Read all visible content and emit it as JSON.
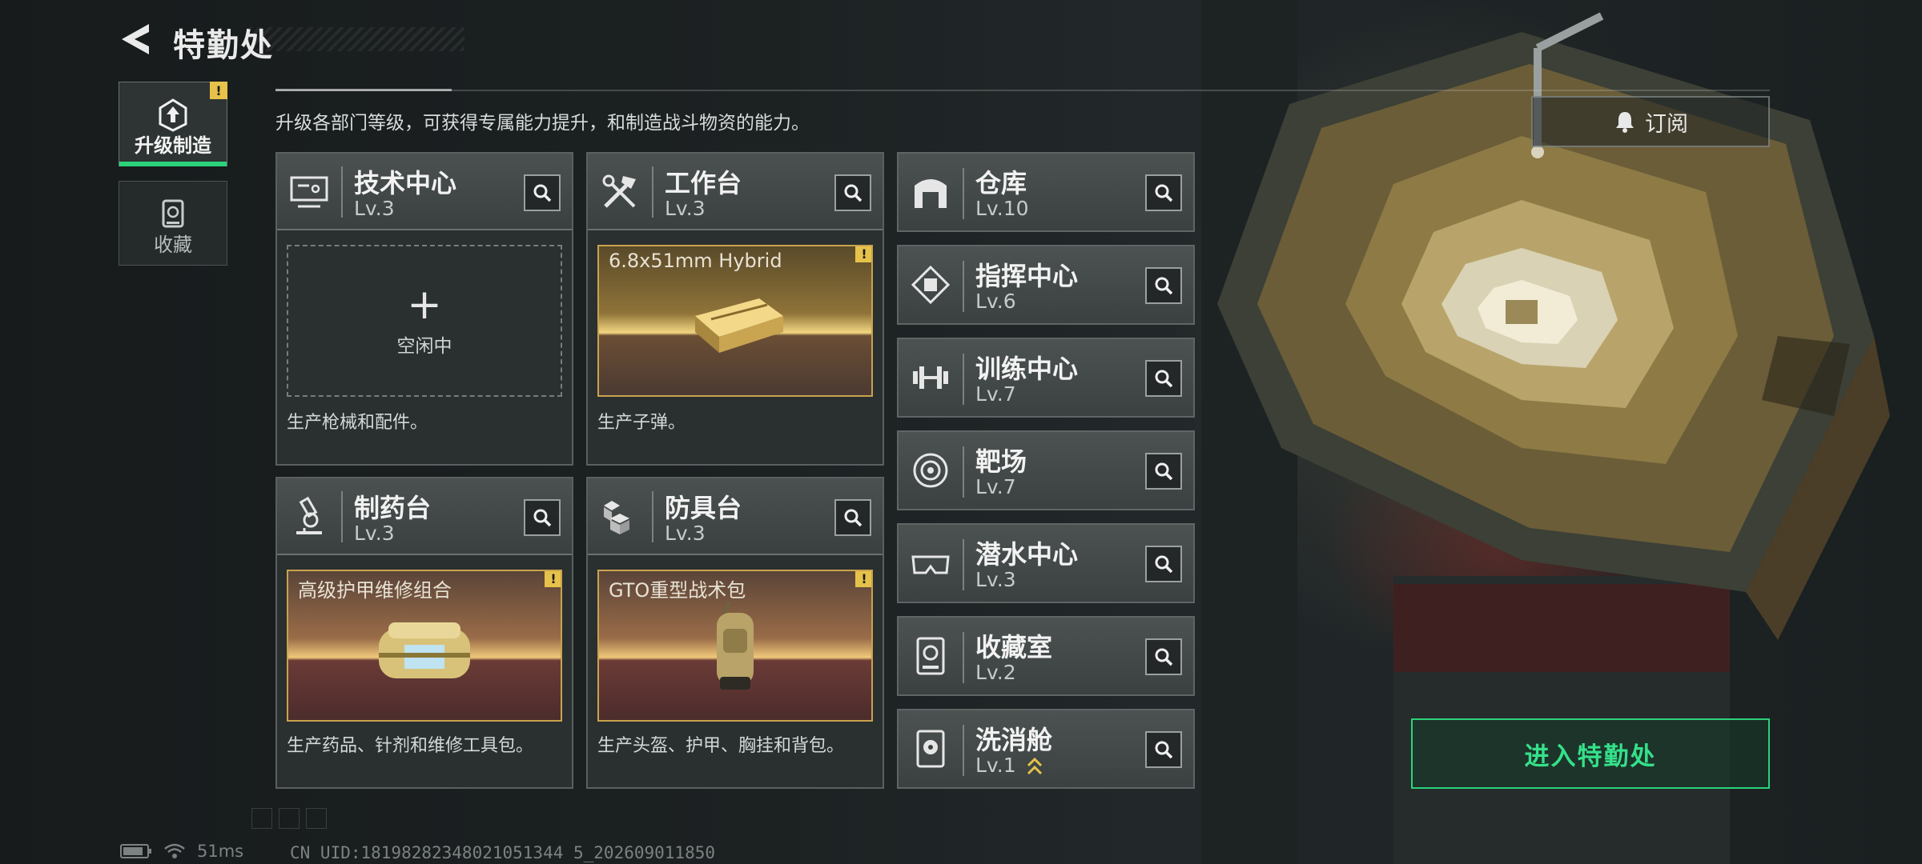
{
  "header": {
    "title": "特勤处"
  },
  "side_tabs": [
    {
      "label": "升级制造",
      "active": true,
      "icon": "upgrade-icon",
      "has_alert": true,
      "alert": "!"
    },
    {
      "label": "收藏",
      "active": false,
      "icon": "collection-icon"
    }
  ],
  "subtitle": "升级各部门等级，可获得专属能力提升，和制造战斗物资的能力。",
  "subscribe": {
    "label": "订阅",
    "icon": "bell-icon"
  },
  "production_facilities": [
    {
      "name": "技术中心",
      "level": "Lv.3",
      "icon": "monitor-icon",
      "status": "idle",
      "idle_plus": "+",
      "idle_label": "空闲中",
      "description": "生产枪械和配件。"
    },
    {
      "name": "工作台",
      "level": "Lv.3",
      "icon": "tools-icon",
      "status": "producing",
      "product": "6.8x51mm Hybrid",
      "product_icon": "ammo-box-icon",
      "alert": "!",
      "description": "生产子弹。"
    },
    {
      "name": "制药台",
      "level": "Lv.3",
      "icon": "microscope-icon",
      "status": "producing",
      "product": "高级护甲维修组合",
      "product_icon": "repair-kit-icon",
      "alert": "!",
      "description": "生产药品、针剂和维修工具包。"
    },
    {
      "name": "防具台",
      "level": "Lv.3",
      "icon": "armor-blocks-icon",
      "status": "producing",
      "product": "GTO重型战术包",
      "product_icon": "backpack-icon",
      "alert": "!",
      "description": "生产头盔、护甲、胸挂和背包。"
    }
  ],
  "departments": [
    {
      "name": "仓库",
      "level": "Lv.10",
      "icon": "warehouse-icon"
    },
    {
      "name": "指挥中心",
      "level": "Lv.6",
      "icon": "command-chip-icon"
    },
    {
      "name": "训练中心",
      "level": "Lv.7",
      "icon": "dumbbell-icon"
    },
    {
      "name": "靶场",
      "level": "Lv.7",
      "icon": "target-icon"
    },
    {
      "name": "潜水中心",
      "level": "Lv.3",
      "icon": "diving-goggles-icon"
    },
    {
      "name": "收藏室",
      "level": "Lv.2",
      "icon": "collection-room-icon"
    },
    {
      "name": "洗消舱",
      "level": "Lv.1",
      "icon": "decontamination-icon",
      "upgrade_indicator": "double-chevron-up-icon"
    }
  ],
  "enter_button": {
    "label": "进入特勤处"
  },
  "status": {
    "battery_icon": "battery-icon",
    "wifi_icon": "wifi-icon",
    "latency": "51ms",
    "uid": "CN UID:18198282348021051344 5_202609011850"
  },
  "colors": {
    "accent_green": "#2bd27a",
    "alert_yellow": "#e6c24a",
    "product_gold": "#c9a34e"
  }
}
